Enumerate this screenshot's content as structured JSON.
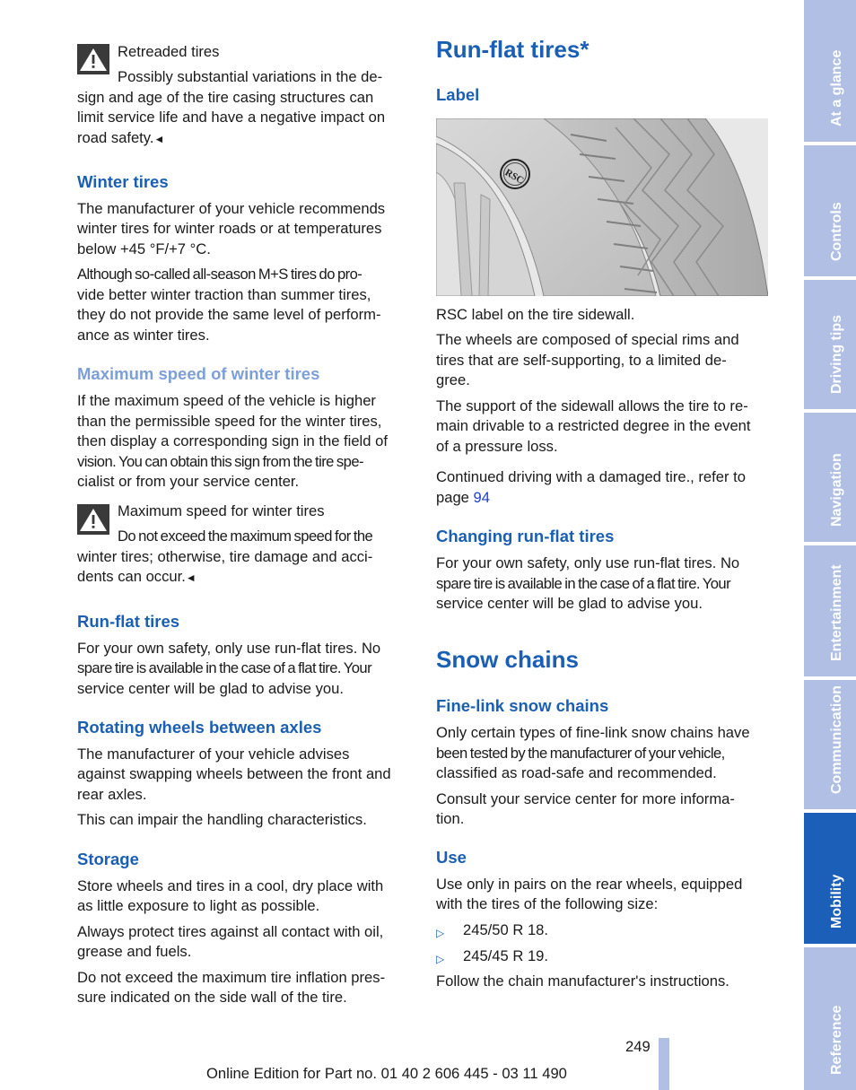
{
  "left_column": {
    "warning1": {
      "icon": "warning-triangle-icon",
      "title": "Retreaded tires",
      "lines": [
        "Possibly substantial variations in the de-",
        "sign and age of the tire casing structures can",
        "limit service life and have a negative impact on",
        "road safety."
      ],
      "end_mark": "◄"
    },
    "winter_tires": {
      "heading": "Winter tires",
      "p1": [
        "The manufacturer of your vehicle recommends",
        "winter tires for winter roads or at temperatures",
        "below +45 °F/+7 °C."
      ],
      "p2": [
        "Although so-called all-season M+S tires do pro-",
        "vide better winter traction than summer tires,",
        "they do not provide the same level of perform-",
        "ance as winter tires."
      ]
    },
    "max_speed": {
      "heading": "Maximum speed of winter tires",
      "p1": [
        "If the maximum speed of the vehicle is higher",
        "than the permissible speed for the winter tires,",
        "then display a corresponding sign in the field of",
        "vision. You can obtain this sign from the tire spe-",
        "cialist or from your service center."
      ]
    },
    "warning2": {
      "icon": "warning-triangle-icon",
      "title": "Maximum speed for winter tires",
      "lines": [
        "Do not exceed the maximum speed for the",
        "winter tires; otherwise, tire damage and acci-",
        "dents can occur."
      ],
      "end_mark": "◄"
    },
    "run_flat": {
      "heading": "Run-flat tires",
      "p1": [
        "For your own safety, only use run-flat tires. No",
        "spare tire is available in the case of a flat tire. Your",
        "service center will be glad to advise you."
      ]
    },
    "rotating": {
      "heading": "Rotating wheels between axles",
      "p1": [
        "The manufacturer of your vehicle advises",
        "against swapping wheels between the front and",
        "rear axles."
      ],
      "p2": [
        "This can impair the handling characteristics."
      ]
    },
    "storage": {
      "heading": "Storage",
      "p1": [
        "Store wheels and tires in a cool, dry place with",
        "as little exposure to light as possible."
      ],
      "p2": [
        "Always protect tires against all contact with oil,",
        "grease and fuels."
      ],
      "p3": [
        "Do not exceed the maximum tire inflation pres-",
        "sure indicated on the side wall of the tire."
      ]
    }
  },
  "right_column": {
    "run_flat_title": "Run-flat tires*",
    "label": {
      "heading": "Label",
      "figure_alt": "Tire sidewall with RSC label",
      "figure_badge": "RSC",
      "caption": "RSC label on the tire sidewall.",
      "p1": [
        "The wheels are composed of special rims and",
        "tires that are self-supporting, to a limited de-",
        "gree."
      ],
      "p2": [
        "The support of the sidewall allows the tire to re-",
        "main drivable to a restricted degree in the event",
        "of a pressure loss."
      ],
      "p3_line1": "Continued driving with a damaged tire., refer to",
      "p3_prefix": "page ",
      "p3_link": "94"
    },
    "changing": {
      "heading": "Changing run-flat tires",
      "p1": [
        "For your own safety, only use run-flat tires. No",
        "spare tire is available in the case of a flat tire. Your",
        "service center will be glad to advise you."
      ]
    },
    "snow_chains_title": "Snow chains",
    "fine_link": {
      "heading": "Fine-link snow chains",
      "p1": [
        "Only certain types of fine-link snow chains have",
        "been tested by the manufacturer of your vehicle,",
        "classified as road-safe and recommended."
      ],
      "p2": [
        "Consult your service center for more informa-",
        "tion."
      ]
    },
    "use": {
      "heading": "Use",
      "p1": [
        "Use only in pairs on the rear wheels, equipped",
        "with the tires of the following size:"
      ],
      "bullet_icon": "▷",
      "bullets": [
        "245/50 R 18.",
        "245/45 R 19."
      ],
      "p2": "Follow the chain manufacturer's instructions."
    }
  },
  "footer": {
    "page_number": "249",
    "edition": "Online Edition for Part no. 01 40 2 606 445 - 03 11 490"
  },
  "side_tabs": [
    {
      "label": "At a glance",
      "active": false
    },
    {
      "label": "Controls",
      "active": false
    },
    {
      "label": "Driving tips",
      "active": false
    },
    {
      "label": "Navigation",
      "active": false
    },
    {
      "label": "Entertainment",
      "active": false
    },
    {
      "label": "Communication",
      "active": false
    },
    {
      "label": "Mobility",
      "active": true
    },
    {
      "label": "Reference",
      "active": false
    }
  ],
  "colors": {
    "heading_blue": "#1a5fb4",
    "subheading_light_blue": "#7d9fd8",
    "tab_inactive": "#b0bfe3",
    "tab_active": "#1b5fb8",
    "link": "#1a3fd4"
  }
}
